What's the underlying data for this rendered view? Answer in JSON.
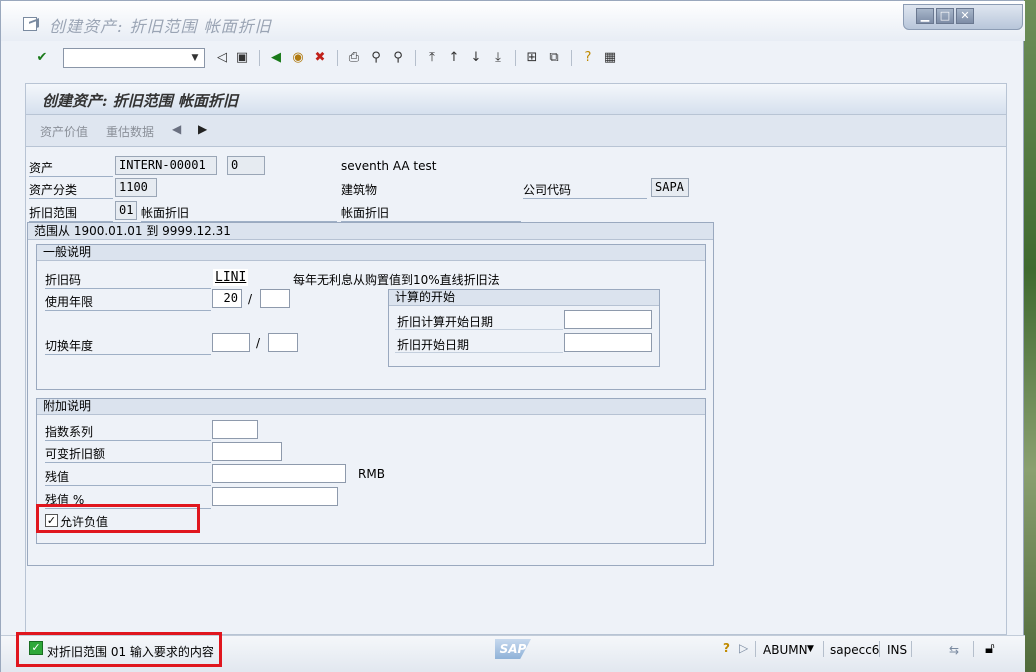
{
  "window": {
    "title": "创建资产: 折旧范围 帐面折旧",
    "controls": {
      "minimize": "▁",
      "maximize": "□",
      "close": "✕"
    }
  },
  "toolbar": {
    "icons": [
      "enter-check-icon",
      "save-icon",
      "back-icon",
      "exit-icon",
      "cancel-icon",
      "print-icon",
      "find-icon",
      "find-next-icon",
      "first-page-icon",
      "prev-page-icon",
      "next-page-icon",
      "last-page-icon",
      "create-session-icon",
      "shortcut-icon",
      "help-icon",
      "customize-layout-icon"
    ]
  },
  "app": {
    "title": "创建资产: 折旧范围 帐面折旧",
    "toolbar": {
      "asset_values": "资产价值",
      "revaluation_data": "重估数据"
    }
  },
  "header": {
    "asset_label": "资产",
    "asset_number": "INTERN-00001",
    "asset_sub": "0",
    "asset_description": "seventh AA test",
    "asset_class_label": "资产分类",
    "asset_class": "1100",
    "asset_class_text": "建筑物",
    "company_code_label": "公司代码",
    "company_code": "SAPA",
    "dep_area_label": "折旧范围",
    "dep_area": "01",
    "dep_area_text": "帐面折旧",
    "dep_area_text2": "帐面折旧"
  },
  "range": {
    "title": "范围从 1900.01.01 到 9999.12.31"
  },
  "general": {
    "title": "一般说明",
    "dep_key_label": "折旧码",
    "dep_key": "LINI",
    "dep_key_text": "每年无利息从购置值到10%直线折旧法",
    "useful_life_label": "使用年限",
    "useful_life_years": "20",
    "useful_life_periods": "",
    "slash1": "/",
    "changeover_label": "切换年度",
    "changeover_year": "",
    "changeover_period": "",
    "slash2": "/",
    "calc_start": {
      "title": "计算的开始",
      "ord_dep_start_label": "折旧计算开始日期",
      "ord_dep_start": "",
      "dep_start_label": "折旧开始日期",
      "dep_start": ""
    }
  },
  "additional": {
    "title": "附加说明",
    "index_series_label": "指数系列",
    "index_series": "",
    "variable_dep_label": "可变折旧额",
    "variable_dep": "",
    "scrap_value_label": "残值",
    "scrap_value": "",
    "currency": "RMB",
    "scrap_pct_label": "残值 %",
    "scrap_pct": "",
    "neg_values_label": "允许负值",
    "neg_values_checked": true
  },
  "status": {
    "message": "对折旧范围 01 输入要求的内容",
    "system": "ABUMN",
    "server": "sapecc6",
    "mode": "INS"
  },
  "colors": {
    "highlight": "#e0161e",
    "success": "#2fa83a"
  }
}
